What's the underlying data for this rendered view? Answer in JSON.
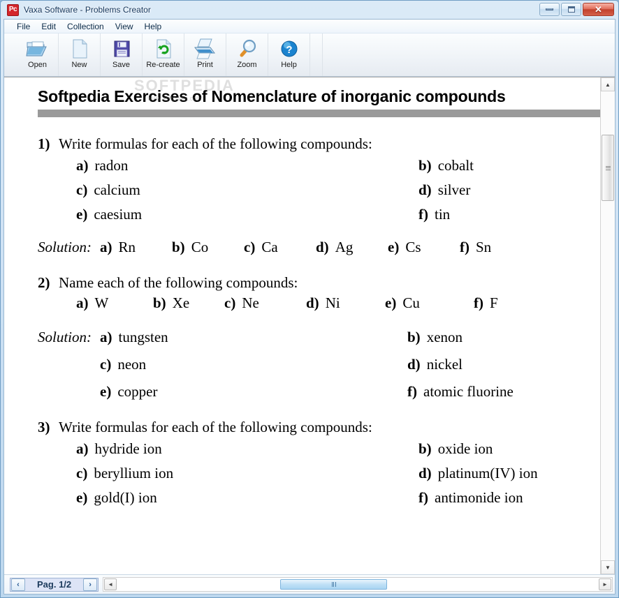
{
  "window": {
    "title": "Vaxa Software - Problems Creator",
    "app_icon_text": "Pc",
    "controls": {
      "minimize": "minimize-button",
      "maximize": "maximize-button",
      "close": "✕"
    }
  },
  "menubar": {
    "items": [
      "File",
      "Edit",
      "Collection",
      "View",
      "Help"
    ]
  },
  "toolbar": {
    "buttons": [
      {
        "label": "Open",
        "icon": "open-folder-icon"
      },
      {
        "label": "New",
        "icon": "new-document-icon"
      },
      {
        "label": "Save",
        "icon": "floppy-disk-icon"
      },
      {
        "label": "Re-create",
        "icon": "refresh-document-icon"
      },
      {
        "label": "Print",
        "icon": "printer-icon"
      },
      {
        "label": "Zoom",
        "icon": "magnifier-icon"
      },
      {
        "label": "Help",
        "icon": "help-question-icon"
      }
    ],
    "watermark": "SOFTPEDIA",
    "watermark_url": "www.softpedia.com"
  },
  "document": {
    "title": "Softpedia Exercises of Nomenclature of inorganic compounds",
    "solution_label": "Solution:",
    "problems": [
      {
        "number": "1)",
        "prompt": "Write formulas for each of the following compounds:",
        "options": [
          {
            "key": "a)",
            "text": "radon"
          },
          {
            "key": "b)",
            "text": "cobalt"
          },
          {
            "key": "c)",
            "text": "calcium"
          },
          {
            "key": "d)",
            "text": "silver"
          },
          {
            "key": "e)",
            "text": "caesium"
          },
          {
            "key": "f)",
            "text": "tin"
          }
        ],
        "solution_layout": "inline",
        "solutions": [
          {
            "key": "a)",
            "text": "Rn"
          },
          {
            "key": "b)",
            "text": "Co"
          },
          {
            "key": "c)",
            "text": "Ca"
          },
          {
            "key": "d)",
            "text": "Ag"
          },
          {
            "key": "e)",
            "text": "Cs"
          },
          {
            "key": "f)",
            "text": "Sn"
          }
        ]
      },
      {
        "number": "2)",
        "prompt": "Name each of the following compounds:",
        "options_layout": "inline",
        "options": [
          {
            "key": "a)",
            "text": "W"
          },
          {
            "key": "b)",
            "text": "Xe"
          },
          {
            "key": "c)",
            "text": "Ne"
          },
          {
            "key": "d)",
            "text": "Ni"
          },
          {
            "key": "e)",
            "text": "Cu"
          },
          {
            "key": "f)",
            "text": "F"
          }
        ],
        "solution_layout": "grid",
        "solutions": [
          {
            "key": "a)",
            "text": "tungsten"
          },
          {
            "key": "b)",
            "text": "xenon"
          },
          {
            "key": "c)",
            "text": "neon"
          },
          {
            "key": "d)",
            "text": "nickel"
          },
          {
            "key": "e)",
            "text": "copper"
          },
          {
            "key": "f)",
            "text": "atomic fluorine"
          }
        ]
      },
      {
        "number": "3)",
        "prompt": "Write formulas for each of the following compounds:",
        "options": [
          {
            "key": "a)",
            "text": "hydride ion"
          },
          {
            "key": "b)",
            "text": "oxide ion"
          },
          {
            "key": "c)",
            "text": "beryllium ion"
          },
          {
            "key": "d)",
            "text": "platinum(IV) ion"
          },
          {
            "key": "e)",
            "text": "gold(I) ion"
          },
          {
            "key": "f)",
            "text": "antimonide ion"
          }
        ]
      }
    ]
  },
  "statusbar": {
    "prev_page_label": "‹",
    "page_indicator": "Pag. 1/2",
    "next_page_label": "›",
    "hscroll_left": "◄",
    "hscroll_right": "►"
  },
  "colors": {
    "accent": "#2c5d96",
    "title_rule": "#9a9a9a",
    "close_button": "#c2412c",
    "app_icon": "#d4262b"
  }
}
